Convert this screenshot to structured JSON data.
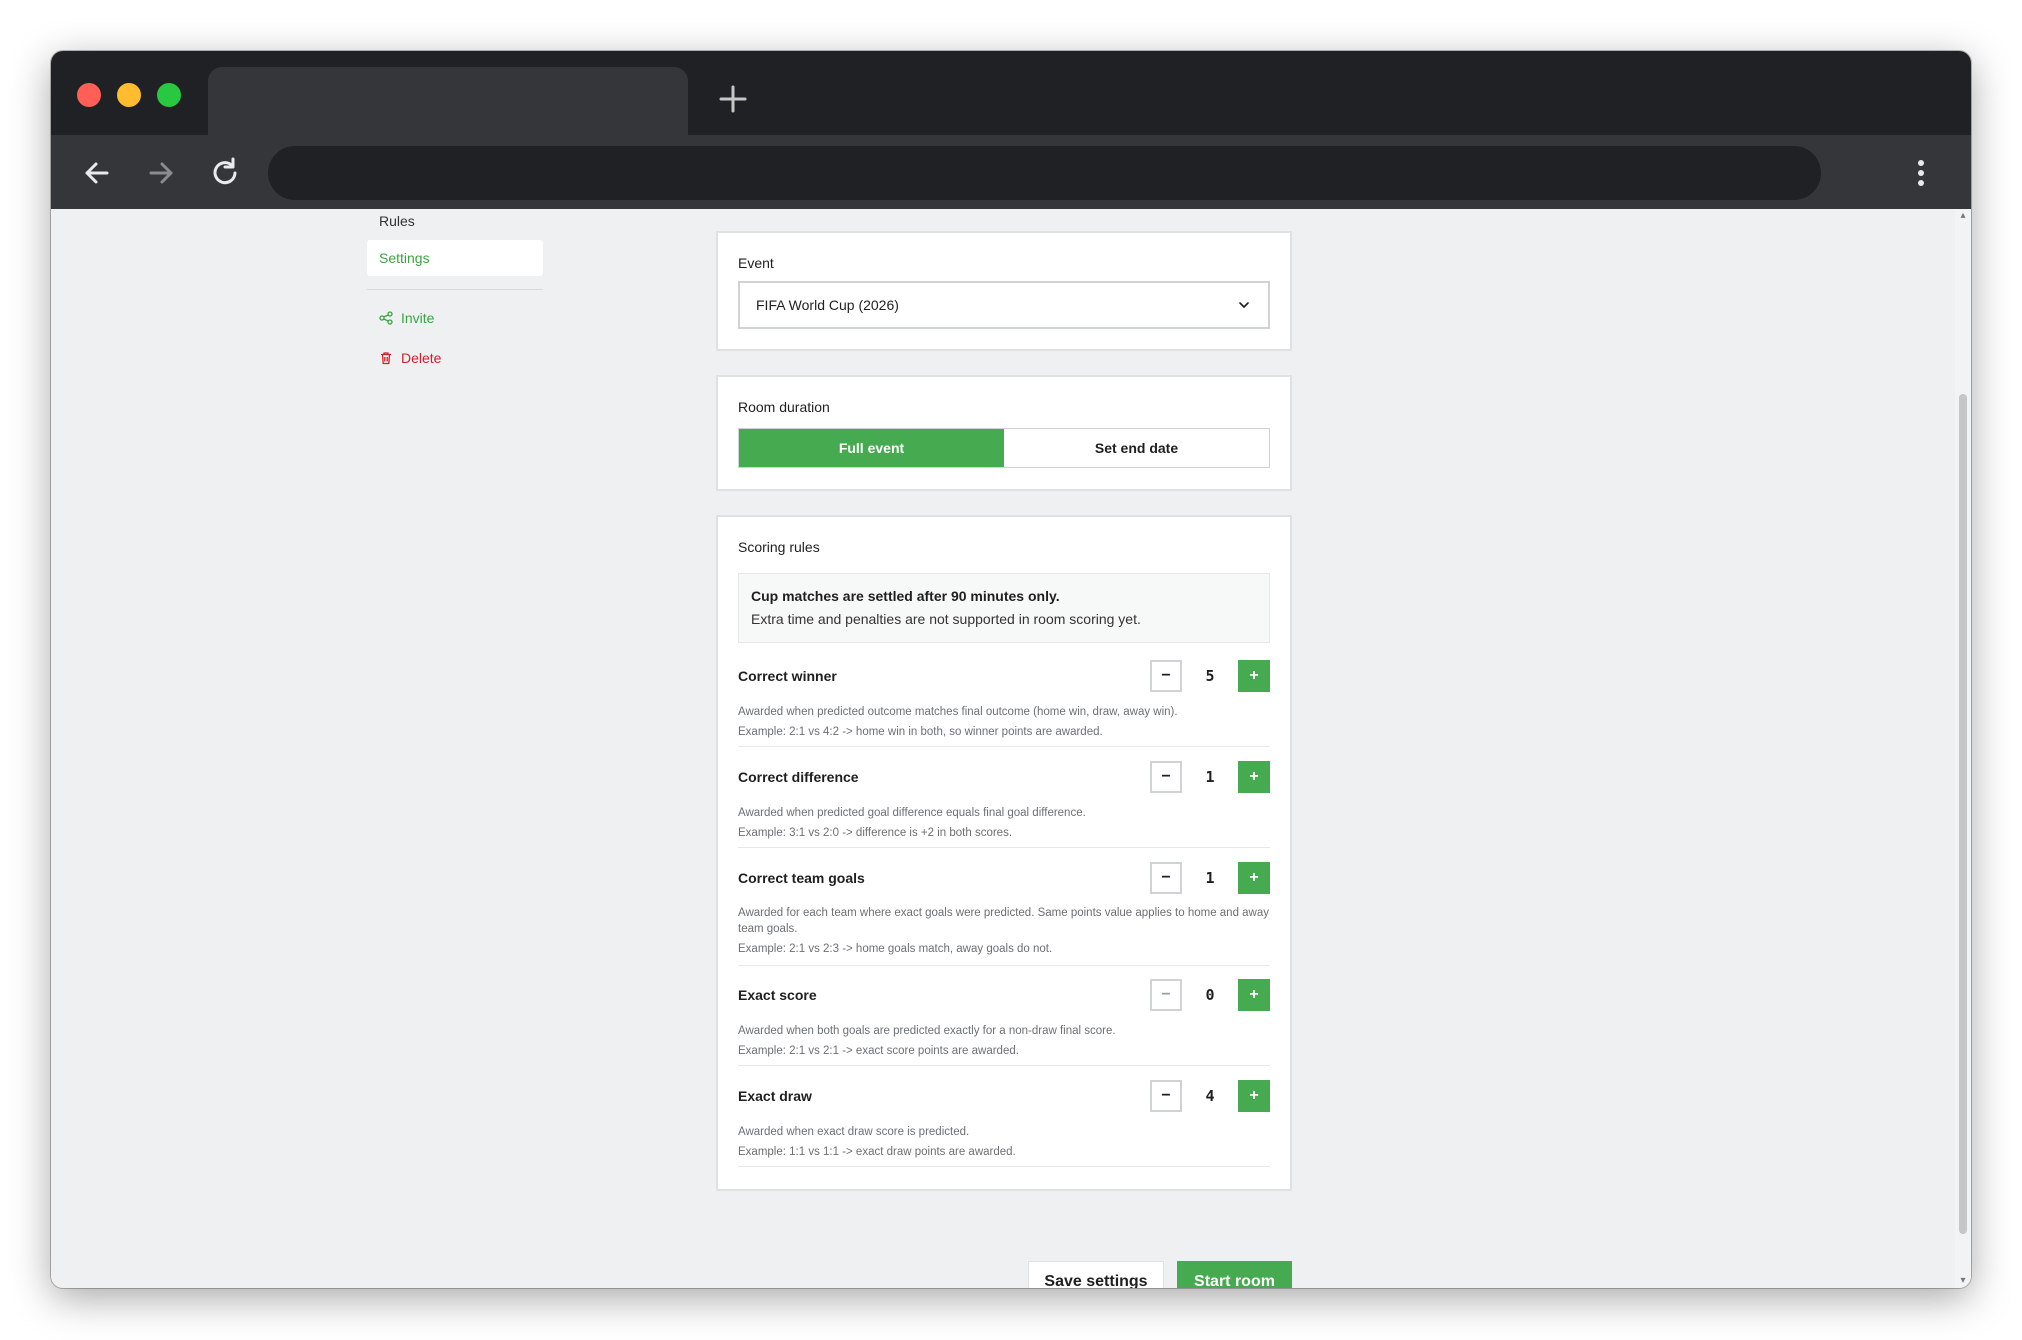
{
  "browser": {
    "tab_title": "",
    "address": ""
  },
  "sidebar": {
    "rules_label": "Rules",
    "settings_label": "Settings",
    "invite_label": "Invite",
    "delete_label": "Delete"
  },
  "event": {
    "label": "Event",
    "selected": "FIFA World Cup (2026)"
  },
  "duration": {
    "label": "Room duration",
    "options": [
      "Full event",
      "Set end date"
    ],
    "selected": "Full event"
  },
  "scoring": {
    "label": "Scoring rules",
    "notice_title": "Cup matches are settled after 90 minutes only.",
    "notice_text": "Extra time and penalties are not supported in room scoring yet.",
    "rules": [
      {
        "title": "Correct winner",
        "value": "5",
        "desc": "Awarded when predicted outcome matches final outcome (home win, draw, away win).",
        "example": "Example: 2:1 vs 4:2 -> home win in both, so winner points are awarded."
      },
      {
        "title": "Correct difference",
        "value": "1",
        "desc": "Awarded when predicted goal difference equals final goal difference.",
        "example": "Example: 3:1 vs 2:0 -> difference is +2 in both scores."
      },
      {
        "title": "Correct team goals",
        "value": "1",
        "desc": "Awarded for each team where exact goals were predicted. Same points value applies to home and away team goals.",
        "example": "Example: 2:1 vs 2:3 -> home goals match, away goals do not."
      },
      {
        "title": "Exact score",
        "value": "0",
        "desc": "Awarded when both goals are predicted exactly for a non-draw final score.",
        "example": "Example: 2:1 vs 2:1 -> exact score points are awarded."
      },
      {
        "title": "Exact draw",
        "value": "4",
        "desc": "Awarded when exact draw score is predicted.",
        "example": "Example: 1:1 vs 1:1 -> exact draw points are awarded."
      }
    ],
    "minus_symbol": "−",
    "plus_symbol": "+"
  },
  "actions": {
    "save_label": "Save settings",
    "start_label": "Start room"
  },
  "colors": {
    "accent": "#46ab50",
    "danger": "#d21f2b"
  }
}
